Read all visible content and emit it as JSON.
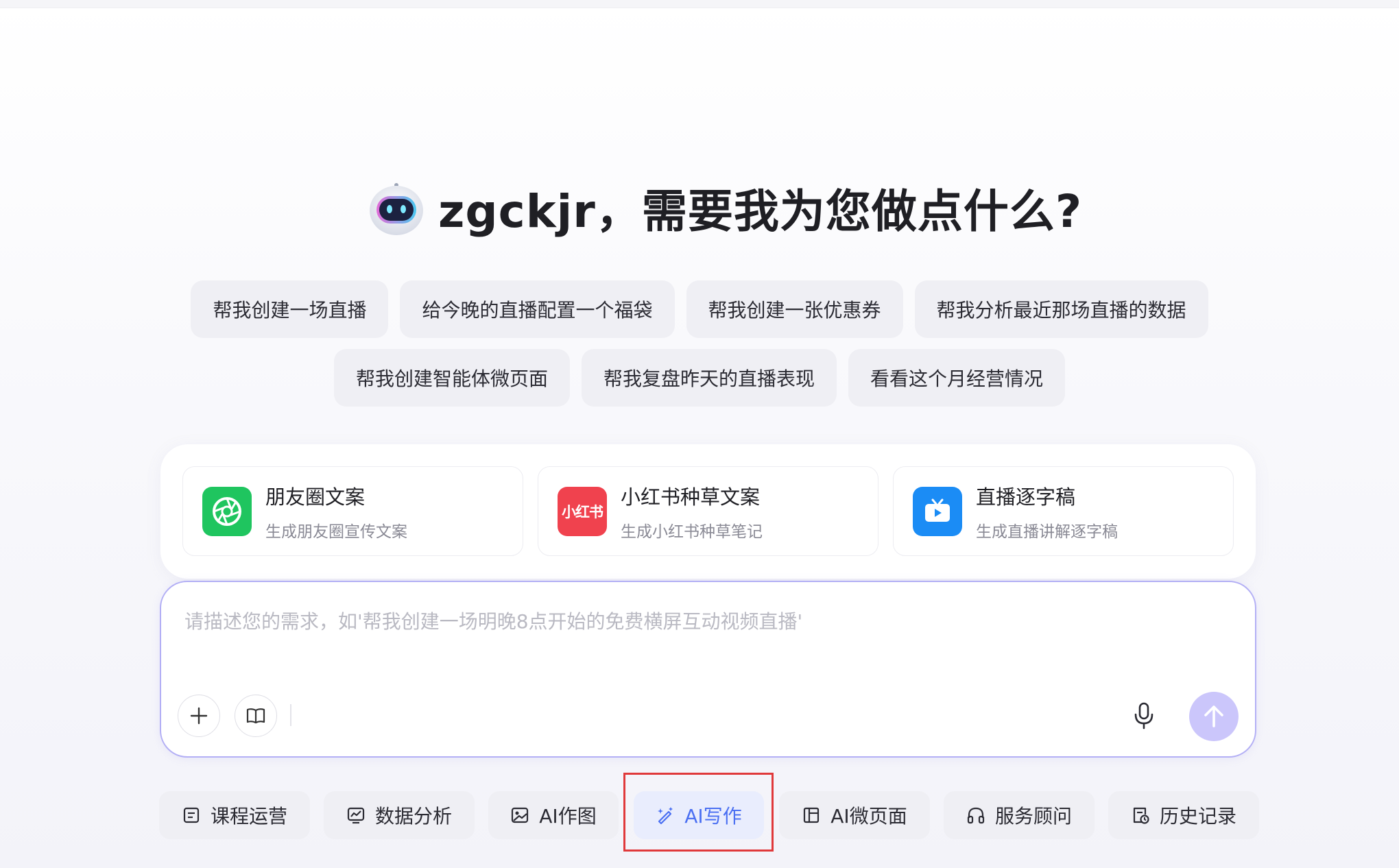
{
  "greeting": {
    "text": "zgckjr，需要我为您做点什么?"
  },
  "suggestions": {
    "row1": [
      "帮我创建一场直播",
      "给今晚的直播配置一个福袋",
      "帮我创建一张优惠券",
      "帮我分析最近那场直播的数据"
    ],
    "row2": [
      "帮我创建智能体微页面",
      "帮我复盘昨天的直播表现",
      "看看这个月经营情况"
    ]
  },
  "tools": [
    {
      "title": "朋友圈文案",
      "subtitle": "生成朋友圈宣传文案",
      "icon": "aperture-icon",
      "color": "#1fc55f"
    },
    {
      "title": "小红书种草文案",
      "subtitle": "生成小红书种草笔记",
      "icon": "xiaohongshu-logo",
      "logo_text": "小红书",
      "color": "#f0424e"
    },
    {
      "title": "直播逐字稿",
      "subtitle": "生成直播讲解逐字稿",
      "icon": "tv-play-icon",
      "color": "#1b8cf5"
    }
  ],
  "input": {
    "placeholder": "请描述您的需求，如'帮我创建一场明晚8点开始的免费横屏互动视频直播'"
  },
  "nav": [
    {
      "label": "课程运营",
      "icon": "list-icon"
    },
    {
      "label": "数据分析",
      "icon": "chart-icon"
    },
    {
      "label": "AI作图",
      "icon": "image-icon"
    },
    {
      "label": "AI写作",
      "icon": "magic-pen-icon",
      "active": true
    },
    {
      "label": "AI微页面",
      "icon": "layout-icon"
    },
    {
      "label": "服务顾问",
      "icon": "headset-icon"
    },
    {
      "label": "历史记录",
      "icon": "history-icon"
    }
  ],
  "colors": {
    "accent": "#4a6ff2",
    "send_button": "#cbc6fb",
    "highlight_border": "#e0393b"
  }
}
